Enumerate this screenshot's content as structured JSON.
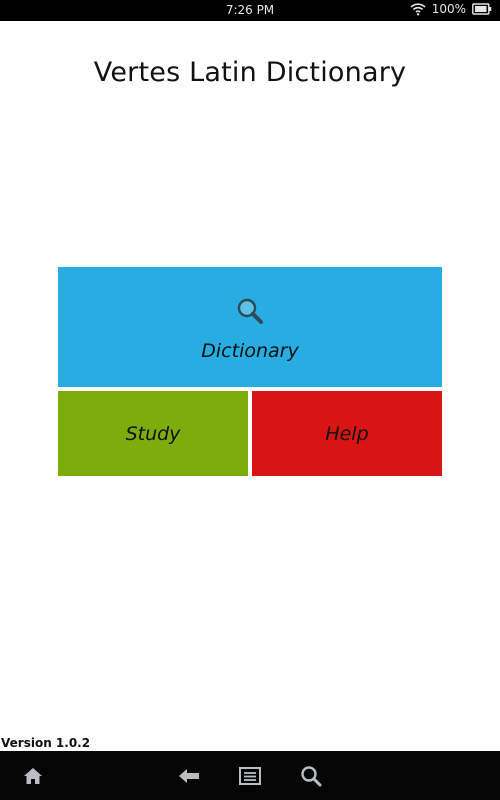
{
  "status_bar": {
    "time": "7:26 PM",
    "battery": "100%",
    "icons": [
      "wifi-icon",
      "battery-icon"
    ]
  },
  "app": {
    "title": "Vertes Latin Dictionary",
    "version": "Version 1.0.2"
  },
  "tiles": {
    "dictionary": {
      "label": "Dictionary",
      "icon": "search-icon",
      "color": "#27ade1"
    },
    "study": {
      "label": "Study",
      "color": "#7dad0c"
    },
    "help": {
      "label": "Help",
      "color": "#d91414"
    }
  },
  "nav_bar": {
    "icons": [
      "home-icon",
      "back-icon",
      "menu-icon",
      "search-icon"
    ]
  }
}
